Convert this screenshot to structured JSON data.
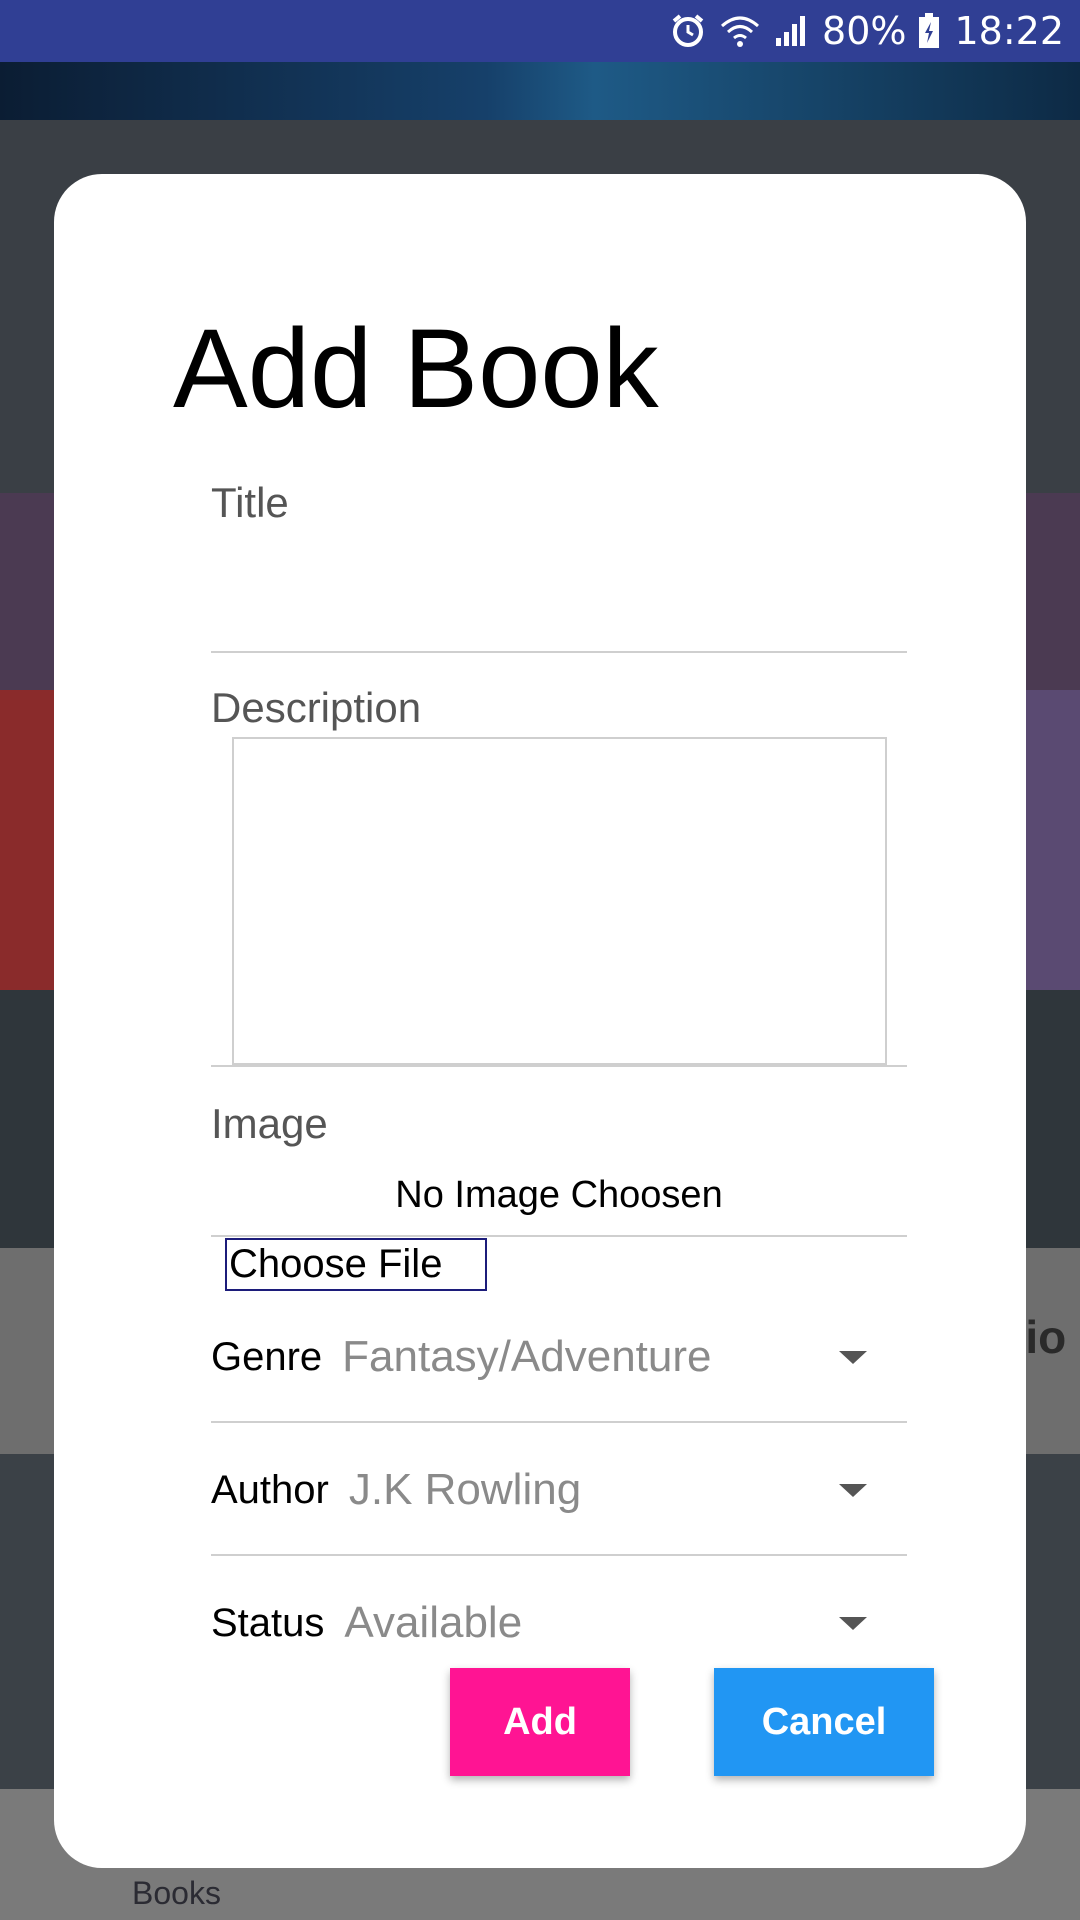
{
  "status_bar": {
    "battery": "80%",
    "time": "18:22",
    "icons": [
      "alarm-icon",
      "wifi-icon",
      "signal-icon",
      "battery-charging-icon"
    ]
  },
  "background": {
    "nav_books_label": "Books",
    "card_text_fragment": "tio"
  },
  "dialog": {
    "title": "Add Book",
    "title_field": {
      "label": "Title",
      "value": ""
    },
    "description_field": {
      "label": "Description",
      "value": ""
    },
    "image_field": {
      "label": "Image",
      "status": "No Image Choosen",
      "choose_button": "Choose File"
    },
    "genre": {
      "label": "Genre",
      "value": "Fantasy/Adventure"
    },
    "author": {
      "label": "Author",
      "value": "J.K Rowling"
    },
    "status": {
      "label": "Status",
      "value": "Available"
    },
    "buttons": {
      "add": "Add",
      "cancel": "Cancel"
    },
    "colors": {
      "add": "#ff1493",
      "cancel": "#2196f3"
    }
  }
}
